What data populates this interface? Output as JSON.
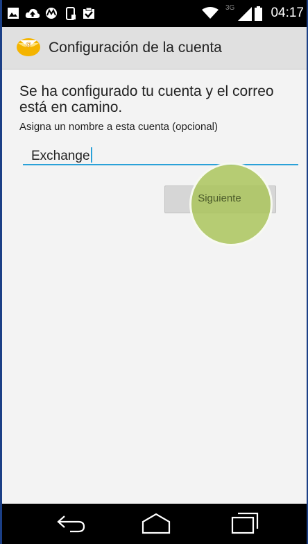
{
  "status_bar": {
    "network": "3G",
    "time": "04:17",
    "icons": [
      "gallery-icon",
      "cloud-upload-icon",
      "motorola-icon",
      "phone-setup-icon",
      "checklist-icon",
      "wifi-icon",
      "signal-icon",
      "battery-icon"
    ]
  },
  "action_bar": {
    "title": "Configuración de la cuenta",
    "icon": "email-app-icon"
  },
  "main": {
    "headline": "Se ha configurado tu cuenta y el correo está en camino.",
    "name_label": "Asigna un nombre a esta cuenta (opcional)",
    "name_value": "Exchange",
    "next_label": "Siguiente"
  },
  "nav_bar": {
    "buttons": [
      "back-icon",
      "home-icon",
      "recent-apps-icon"
    ]
  },
  "colors": {
    "accent": "#2aa1d8",
    "touch_highlight": "#aac45c",
    "status_bar": "#000000",
    "action_bar": "#e0e0e0"
  }
}
